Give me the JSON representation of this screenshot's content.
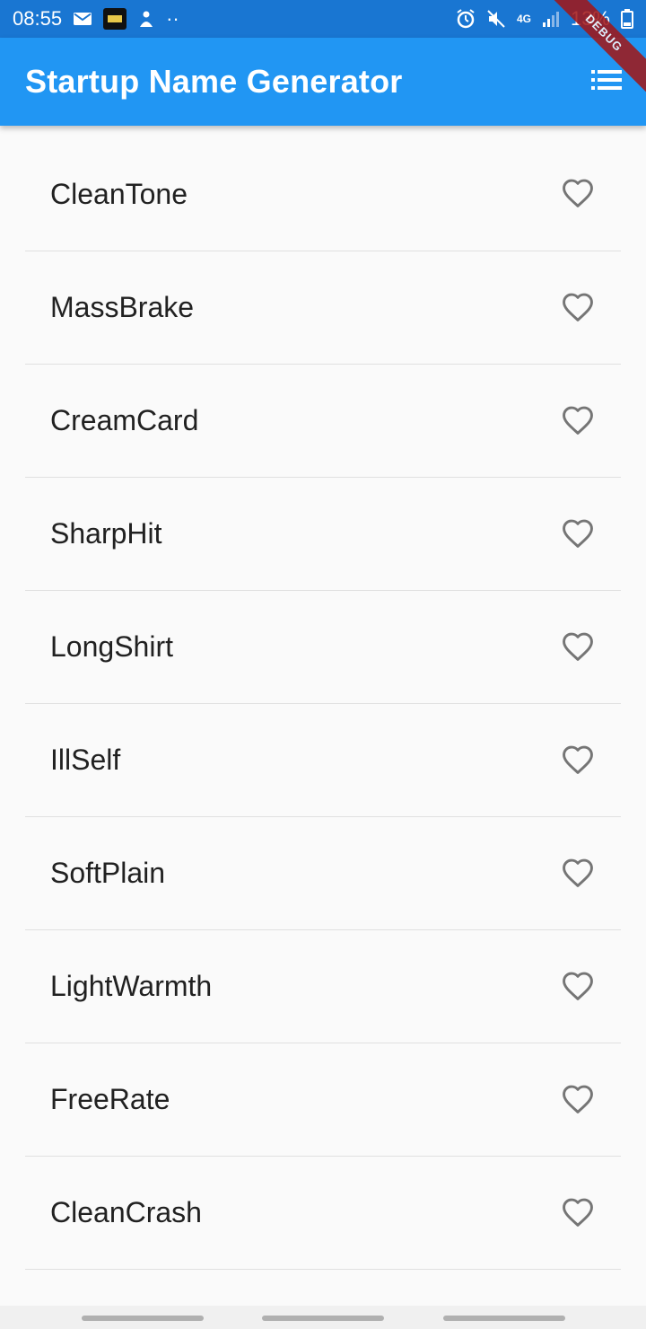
{
  "status_bar": {
    "time": "08:55",
    "dots": "··",
    "network_type": "4G",
    "battery_percent": "13%",
    "icons": [
      "gmail-icon",
      "game-app-icon",
      "notification-icon",
      "alarm-icon",
      "mute-icon",
      "signal-icon",
      "battery-icon"
    ]
  },
  "app_bar": {
    "title": "Startup Name Generator",
    "action_icon": "list-icon"
  },
  "debug_banner": "DEBUG",
  "names": [
    {
      "label": "CleanTone",
      "favorite": false
    },
    {
      "label": "MassBrake",
      "favorite": false
    },
    {
      "label": "CreamCard",
      "favorite": false
    },
    {
      "label": "SharpHit",
      "favorite": false
    },
    {
      "label": "LongShirt",
      "favorite": false
    },
    {
      "label": "IllSelf",
      "favorite": false
    },
    {
      "label": "SoftPlain",
      "favorite": false
    },
    {
      "label": "LightWarmth",
      "favorite": false
    },
    {
      "label": "FreeRate",
      "favorite": false
    },
    {
      "label": "CleanCrash",
      "favorite": false
    }
  ],
  "colors": {
    "status_bar": "#1976d2",
    "app_bar": "#2196f3",
    "heart_outline": "#757575",
    "text": "#212121"
  }
}
